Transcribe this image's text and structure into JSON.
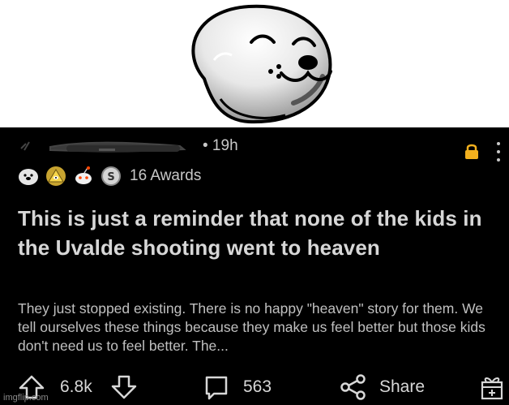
{
  "header_image": {
    "icon": "smiling-seal-icon"
  },
  "post": {
    "time": "• 19h",
    "awards_label": "16 Awards",
    "award_icons": [
      "seal-award-icon",
      "triangle-eye-award-icon",
      "snoo-award-icon",
      "silver-coin-award-icon"
    ],
    "title": "This is just a reminder that none of the kids in the Uvalde shooting went to heaven",
    "body": "They just stopped existing. There is no happy \"heaven\" story for them. We tell ourselves these things because they make us feel better but those kids don't need us to feel better. The...",
    "lock_color": "#f2b01e"
  },
  "actions": {
    "score": "6.8k",
    "comments": "563",
    "share": "Share"
  },
  "watermark": "imgflip.com"
}
